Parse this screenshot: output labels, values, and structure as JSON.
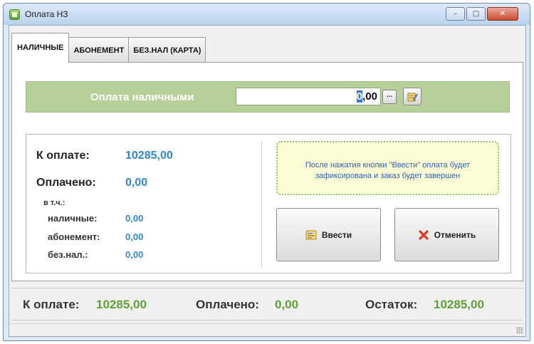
{
  "window": {
    "title": "Оплата НЗ",
    "controls": {
      "minimize": "–",
      "maximize": "□",
      "close": "✕"
    }
  },
  "tabs": [
    {
      "label": "НАЛИЧНЫЕ",
      "active": true
    },
    {
      "label": "АБОНЕМЕНТ",
      "active": false
    },
    {
      "label": "БЕЗ.НАЛ (КАРТА)",
      "active": false
    }
  ],
  "cash_payment": {
    "label": "Оплата наличными",
    "amount_cursor": "0",
    "amount_rest": ",00",
    "dots_button": "...",
    "edit_icon": "edit-icon"
  },
  "details": {
    "to_pay_label": "К оплате:",
    "to_pay_value": "10285,00",
    "paid_label": "Оплачено:",
    "paid_value": "0,00",
    "including_label": "в т.ч.:",
    "cash_label": "наличные:",
    "cash_value": "0,00",
    "subscription_label": "абонемент:",
    "subscription_value": "0,00",
    "cashless_label": "без.нал.:",
    "cashless_value": "0,00"
  },
  "note": {
    "line1": "После нажатия кнопки \"Ввести\" оплата будет",
    "line2": "зафиксирована и заказ будет завершен"
  },
  "buttons": {
    "enter": "Ввести",
    "cancel": "Отменить"
  },
  "summary": {
    "to_pay_label": "К оплате:",
    "to_pay_value": "10285,00",
    "paid_label": "Оплачено:",
    "paid_value": "0,00",
    "remaining_label": "Остаток:",
    "remaining_value": "10285,00"
  },
  "colors": {
    "accent_blue": "#2f87d2",
    "accent_green": "#60a135",
    "band_green": "#b7cf98"
  }
}
